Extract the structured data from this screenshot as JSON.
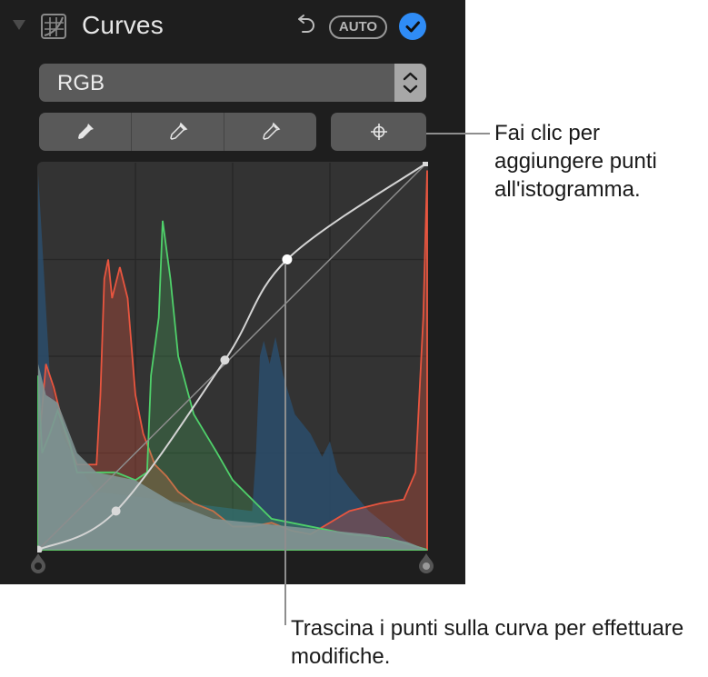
{
  "header": {
    "title": "Curves",
    "auto_label": "AUTO",
    "icons": [
      "disclosure-triangle-icon",
      "curves-icon",
      "undo-icon",
      "checkmark-icon"
    ]
  },
  "channel_select": {
    "value": "RGB"
  },
  "tools": {
    "eyedroppers": [
      "black-point-eyedropper",
      "gray-point-eyedropper",
      "white-point-eyedropper"
    ],
    "add_points_icon": "crosshair-icon"
  },
  "colors": {
    "accent": "#2f8cf6",
    "panel_bg": "#1e1e1e",
    "red": "#e8553f",
    "green": "#4fd06a",
    "blue": "#2c4e6c",
    "luminance": "#7f9494"
  },
  "curve": {
    "points": [
      [
        0,
        0
      ],
      [
        0.2,
        0.1
      ],
      [
        0.48,
        0.49
      ],
      [
        0.64,
        0.75
      ],
      [
        1,
        1
      ]
    ]
  },
  "callouts": {
    "add_points": "Fai clic per aggiungere punti all'istogramma.",
    "drag_points": "Trascina i punti sulla curva per effettuare modifiche."
  }
}
